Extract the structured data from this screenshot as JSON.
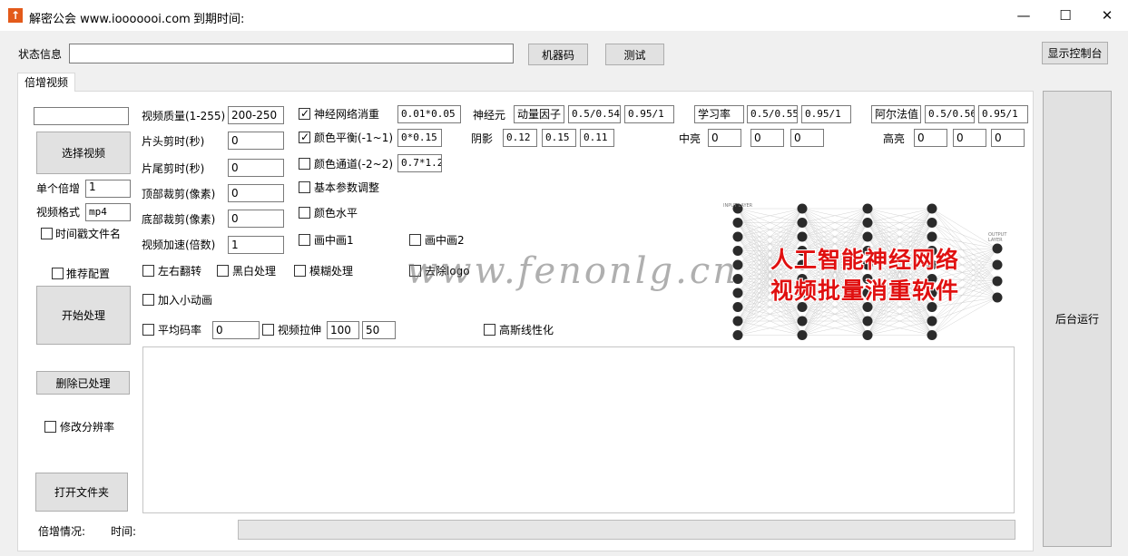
{
  "window": {
    "title": "解密公会 www.iooooooi.com",
    "expire_label": "到期时间:",
    "minimize_glyph": "—",
    "maximize_glyph": "☐",
    "close_glyph": "✕",
    "app_icon_glyph": "↑"
  },
  "status": {
    "label": "状态信息",
    "value": "",
    "machine_code_button": "机器码",
    "test_button": "测试",
    "console_button": "显示控制台"
  },
  "tabs": [
    {
      "label": "倍增视频"
    }
  ],
  "left": {
    "top_input": "",
    "select_video_button": "选择视频",
    "multiply_label": "单个倍增",
    "multiply_value": "1",
    "format_label": "视频格式",
    "format_value": "mp4",
    "timestamp_label": "时间戳文件名",
    "recommend_label": "推荐配置",
    "start_button": "开始处理",
    "delete_button": "删除已处理",
    "resolution_label": "修改分辨率",
    "open_folder_button": "打开文件夹",
    "progress_label": "倍增情况:",
    "time_label": "时间:"
  },
  "params": {
    "quality_label": "视频质量(1-255)",
    "quality_value": "200-250",
    "head_cut_label": "片头剪时(秒)",
    "head_cut_value": "0",
    "tail_cut_label": "片尾剪时(秒)",
    "tail_cut_value": "0",
    "top_crop_label": "顶部裁剪(像素)",
    "top_crop_value": "0",
    "bottom_crop_label": "底部裁剪(像素)",
    "bottom_crop_value": "0",
    "speed_label": "视频加速(倍数)",
    "speed_value": "1"
  },
  "effects": {
    "nn_label": "神经网络消重",
    "nn_checked": true,
    "nn_value": "0.01*0.05",
    "color_balance_label": "颜色平衡(-1~1)",
    "color_balance_checked": true,
    "color_balance_value": "0*0.15",
    "color_channel_label": "颜色通道(-2~2)",
    "color_channel_checked": false,
    "color_channel_value": "0.7*1.2",
    "basic_label": "基本参数调整",
    "color_level_label": "颜色水平",
    "pip1_label": "画中画1",
    "pip2_label": "画中画2",
    "flip_label": "左右翻转",
    "bw_label": "黑白处理",
    "blur_label": "模糊处理",
    "logo_label": "去除logo",
    "animation_label": "加入小动画",
    "bitrate_label": "平均码率",
    "bitrate_value": "0",
    "stretch_label": "视频拉伸",
    "stretch_w": "100",
    "stretch_h": "50",
    "gauss_label": "高斯线性化"
  },
  "neuron": {
    "label": "神经元",
    "momentum_label": "动量因子",
    "momentum_v1": "0.5/0.54",
    "momentum_v2": "0.95/1",
    "lr_label": "学习率",
    "lr_v1": "0.5/0.55",
    "lr_v2": "0.95/1",
    "alpha_label": "阿尔法值",
    "alpha_v1": "0.5/0.56",
    "alpha_v2": "0.95/1"
  },
  "tones": {
    "shadow_label": "阴影",
    "shadow": [
      "0.12",
      "0.15",
      "0.11"
    ],
    "mid_label": "中亮",
    "mid": [
      "0",
      "0",
      "0"
    ],
    "high_label": "高亮",
    "high": [
      "0",
      "0",
      "0"
    ]
  },
  "banner": {
    "line1": "人工智能神经网络",
    "line2": "视频批量消重软件",
    "input_layer": "INPUT LAYER",
    "output_layer": "OUTPUT LAYER"
  },
  "watermark": "www.fenonlg.cn",
  "right": {
    "background_run_button": "后台运行"
  }
}
